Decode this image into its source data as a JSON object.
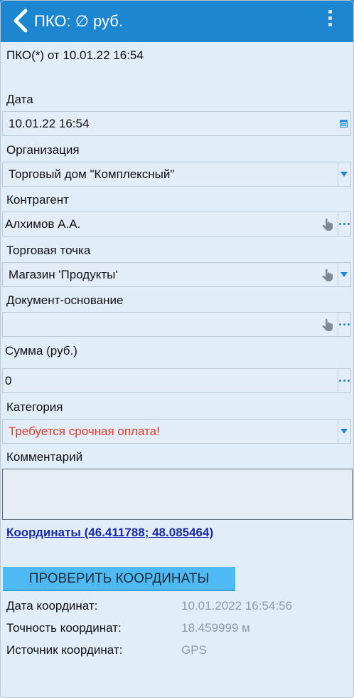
{
  "header": {
    "title": "ПКО: ∅ руб.",
    "back_icon": "chevron-left-icon",
    "menu_icon": "overflow-menu-icon"
  },
  "document": {
    "title": "ПКО(*) от 10.01.22 16:54"
  },
  "form": {
    "date": {
      "label": "Дата",
      "value": "10.01.22 16:54",
      "icon": "calendar-icon"
    },
    "organization": {
      "label": "Организация",
      "value": "Торговый дом \"Комплексный\""
    },
    "counterparty": {
      "label": "Контрагент",
      "value": "Алхимов А.А."
    },
    "outlet": {
      "label": "Торговая точка",
      "value": "Магазин 'Продукты'"
    },
    "base_document": {
      "label": "Документ-основание",
      "value": ""
    },
    "amount": {
      "label": "Сумма (руб.)",
      "value": "0"
    },
    "category": {
      "label": "Категория",
      "value": "Требуется срочная оплата!"
    },
    "comment": {
      "label": "Комментарий",
      "value": ""
    }
  },
  "coordinates": {
    "link": "Координаты (46.411788; 48.085464)",
    "check_button": "ПРОВЕРИТЬ КООРДИНАТЫ",
    "date_label": "Дата координат:",
    "date_value": "10.01.2022 16:54:56",
    "accuracy_label": "Точность координат:",
    "accuracy_value": "18.459999 м",
    "source_label": "Источник координат:",
    "source_value": "GPS"
  },
  "colors": {
    "appbar": "#1c86d1",
    "background": "#e1eefa",
    "warning_text": "#e33b2a",
    "link": "#1a2aa9",
    "button": "#4fb9f3"
  }
}
